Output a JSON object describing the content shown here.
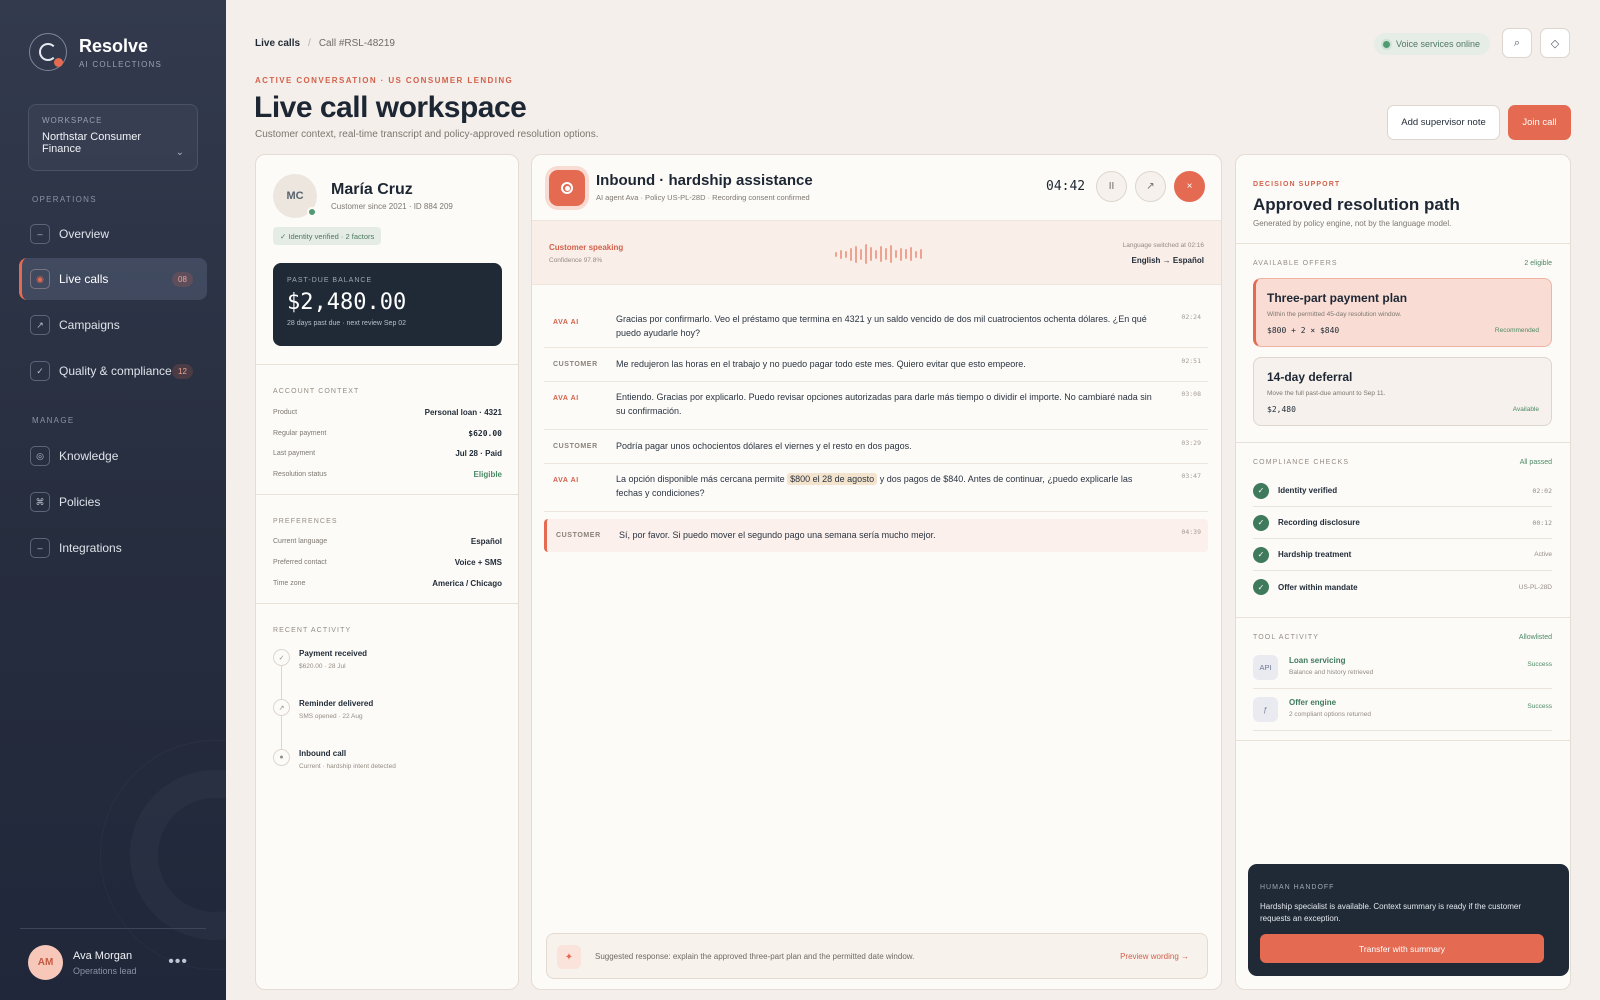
{
  "brand": {
    "name": "Resolve",
    "sub": "AI COLLECTIONS"
  },
  "workspace": {
    "label": "WORKSPACE",
    "name": "Northstar Consumer Finance"
  },
  "nav": {
    "operations_label": "OPERATIONS",
    "manage_label": "MANAGE",
    "operations": [
      {
        "label": "Overview",
        "icon": "–",
        "badge": ""
      },
      {
        "label": "Live calls",
        "icon": "◉",
        "badge": "08",
        "active": true
      },
      {
        "label": "Campaigns",
        "icon": "↗",
        "badge": ""
      },
      {
        "label": "Quality & compliance",
        "icon": "✓",
        "badge": "12"
      }
    ],
    "manage": [
      {
        "label": "Knowledge",
        "icon": "◎"
      },
      {
        "label": "Policies",
        "icon": "⌘"
      },
      {
        "label": "Integrations",
        "icon": "–"
      }
    ]
  },
  "user": {
    "initials": "AM",
    "name": "Ava Morgan",
    "role": "Operations lead",
    "more": "•••"
  },
  "header": {
    "breadcrumb": [
      "Live calls",
      "/",
      "Call #RSL-48219"
    ],
    "status": "Voice services online",
    "search_icon": "⌕",
    "settings_icon": "◇",
    "eyebrow": "ACTIVE CONVERSATION · US CONSUMER LENDING",
    "title": "Live call workspace",
    "subtitle": "Customer context, real-time transcript and policy-approved resolution options.",
    "note_button": "Add supervisor note",
    "join_button": "Join call"
  },
  "customer": {
    "initials": "MC",
    "name": "María Cruz",
    "meta": "Customer since 2021 · ID 884 209",
    "verified": "✓ Identity verified · 2 factors",
    "balance_label": "PAST-DUE BALANCE",
    "balance": "$2,480.00",
    "balance_meta": "28 days past due · next review Sep 02",
    "account_label": "ACCOUNT CONTEXT",
    "account": [
      {
        "k": "Product",
        "v": "Personal loan · 4321"
      },
      {
        "k": "Regular payment",
        "v": "$620.00"
      },
      {
        "k": "Last payment",
        "v": "Jul 28 · Paid"
      },
      {
        "k": "Resolution status",
        "v": "Eligible"
      }
    ],
    "pref_label": "PREFERENCES",
    "preferences": [
      {
        "k": "Current language",
        "v": "Español"
      },
      {
        "k": "Preferred contact",
        "v": "Voice + SMS"
      },
      {
        "k": "Time zone",
        "v": "America / Chicago"
      }
    ],
    "activity_label": "RECENT ACTIVITY",
    "activity": [
      {
        "icon": "✓",
        "title": "Payment received",
        "sub": "$620.00 · 28 Jul"
      },
      {
        "icon": "↗",
        "title": "Reminder delivered",
        "sub": "SMS opened · 22 Aug"
      },
      {
        "icon": "●",
        "title": "Inbound call",
        "sub": "Current · hardship intent detected"
      }
    ]
  },
  "call": {
    "title": "Inbound · hardship assistance",
    "meta": "AI agent Ava · Policy US-PL-28D · Recording consent confirmed",
    "timer": "04:42",
    "pause_icon": "II",
    "transfer_icon": "↗",
    "end_icon": "×",
    "speaking": "Customer speaking",
    "confidence": "Confidence 97.8%",
    "lang_switch": "Language switched at 02:16",
    "lang": "English → Español",
    "transcript": [
      {
        "who": "AVA AI",
        "text": "Gracias por confirmarlo. Veo el préstamo que termina en 4321 y un saldo vencido de dos mil cuatrocientos ochenta dólares. ¿En qué puedo ayudarle hoy?",
        "ts": "02:24"
      },
      {
        "who": "CUSTOMER",
        "text": "Me redujeron las horas en el trabajo y no puedo pagar todo este mes. Quiero evitar que esto empeore.",
        "ts": "02:51"
      },
      {
        "who": "AVA AI",
        "text": "Entiendo. Gracias por explicarlo. Puedo revisar opciones autorizadas para darle más tiempo o dividir el importe. No cambiaré nada sin su confirmación.",
        "ts": "03:08"
      },
      {
        "who": "CUSTOMER",
        "text": "Podría pagar unos ochocientos dólares el viernes y el resto en dos pagos.",
        "ts": "03:29"
      },
      {
        "who": "AVA AI",
        "text_before": "La opción disponible más cercana permite ",
        "text_hl": "$800 el 28 de agosto",
        "text_after": " y dos pagos de $840. Antes de continuar, ¿puedo explicarle las fechas y condiciones?",
        "ts": "03:47"
      },
      {
        "who": "CUSTOMER",
        "text": "Sí, por favor. Si puedo mover el segundo pago una semana sería mucho mejor.",
        "ts": "04:39"
      }
    ],
    "suggest_icon": "✦",
    "suggestion": "Suggested response: explain the approved three-part plan and the permitted date window.",
    "preview": "Preview wording →"
  },
  "decision": {
    "eyebrow": "DECISION SUPPORT",
    "title": "Approved resolution path",
    "subtitle": "Generated by policy engine, not by the language model.",
    "offers_label": "AVAILABLE OFFERS",
    "offers_count": "2 eligible",
    "offers": [
      {
        "title": "Three-part payment plan",
        "desc": "Within the permitted 45-day resolution window.",
        "amount": "$800 + 2 × $840",
        "status": "Recommended"
      },
      {
        "title": "14-day deferral",
        "desc": "Move the full past-due amount to Sep 11.",
        "amount": "$2,480",
        "status": "Available"
      }
    ],
    "checks_label": "COMPLIANCE CHECKS",
    "checks_status": "All passed",
    "checks": [
      {
        "label": "Identity verified",
        "value": "02:02"
      },
      {
        "label": "Recording disclosure",
        "value": "00:12"
      },
      {
        "label": "Hardship treatment",
        "value": "Active"
      },
      {
        "label": "Offer within mandate",
        "value": "US-PL-28D"
      }
    ],
    "tools_label": "TOOL ACTIVITY",
    "tools_status": "Allowlisted",
    "tools": [
      {
        "icon": "API",
        "name": "Loan servicing",
        "desc": "Balance and history retrieved",
        "status": "Success"
      },
      {
        "icon": "ƒ",
        "name": "Offer engine",
        "desc": "2 compliant options returned",
        "status": "Success"
      }
    ],
    "handoff_label": "HUMAN HANDOFF",
    "handoff_text": "Hardship specialist is available. Context summary is ready if the customer requests an exception.",
    "handoff_button": "Transfer with summary"
  }
}
